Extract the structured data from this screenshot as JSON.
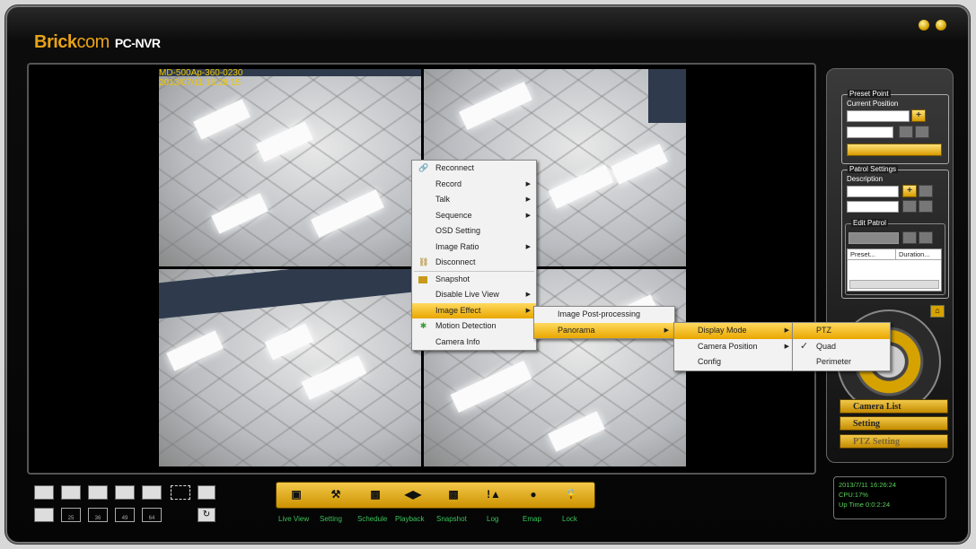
{
  "app": {
    "brand_prefix": "Brick",
    "brand_suffix": "com",
    "product": "PC-NVR"
  },
  "osd": {
    "line1": "MD-500Ap-360-0230",
    "line2": "2013/07/11 16:28:15"
  },
  "context_menu": {
    "items": [
      {
        "label": "Reconnect",
        "icon": "link-icon"
      },
      {
        "label": "Record",
        "submenu": true
      },
      {
        "label": "Talk",
        "submenu": true
      },
      {
        "label": "Sequence",
        "submenu": true
      },
      {
        "label": "OSD Setting"
      },
      {
        "label": "Image Ratio",
        "submenu": true
      },
      {
        "label": "Disconnect",
        "icon": "unlink-icon"
      },
      {
        "label": "Snapshot",
        "icon": "camera-icon"
      },
      {
        "label": "Disable Live View",
        "submenu": true
      },
      {
        "label": "Image Effect",
        "submenu": true,
        "selected": true
      },
      {
        "label": "Motion Detection",
        "icon": "motion-icon"
      },
      {
        "label": "Camera Info"
      }
    ]
  },
  "image_effect_menu": {
    "items": [
      {
        "label": "Image Post-processing"
      },
      {
        "label": "Panorama",
        "submenu": true,
        "selected": true
      }
    ]
  },
  "panorama_menu": {
    "items": [
      {
        "label": "Display Mode",
        "submenu": true,
        "selected": true
      },
      {
        "label": "Camera Position",
        "submenu": true
      },
      {
        "label": "Config"
      }
    ]
  },
  "display_mode_menu": {
    "items": [
      {
        "label": "PTZ",
        "selected": true
      },
      {
        "label": "Quad",
        "checked": true
      },
      {
        "label": "Perimeter"
      }
    ]
  },
  "side_panel": {
    "preset_point": "Preset Point",
    "current_position": "Current Position",
    "patrol_settings": "Patrol Settings",
    "description": "Description",
    "edit_patrol": "Edit Patrol",
    "col_preset": "Preset...",
    "col_duration": "Duration..."
  },
  "side_buttons": {
    "camera_list": "Camera List",
    "setting": "Setting",
    "ptz_setting": "PTZ Setting"
  },
  "status": {
    "time": "2013/7/11 16:26:24",
    "cpu": "CPU:17%",
    "uptime": "Up Time 0:0:2:24"
  },
  "layouts": {
    "n25": "25",
    "n36": "36",
    "n49": "49",
    "n64": "64"
  },
  "toolbar": {
    "live_view": "Live View",
    "setting": "Setting",
    "schedule": "Schedule",
    "playback": "Playback",
    "snapshot": "Snapshot",
    "log": "Log",
    "emap": "Emap",
    "lock": "Lock"
  },
  "colors": {
    "accent": "#e8a317",
    "status_green": "#5cd05c",
    "menu_highlight": "#f0b400"
  }
}
